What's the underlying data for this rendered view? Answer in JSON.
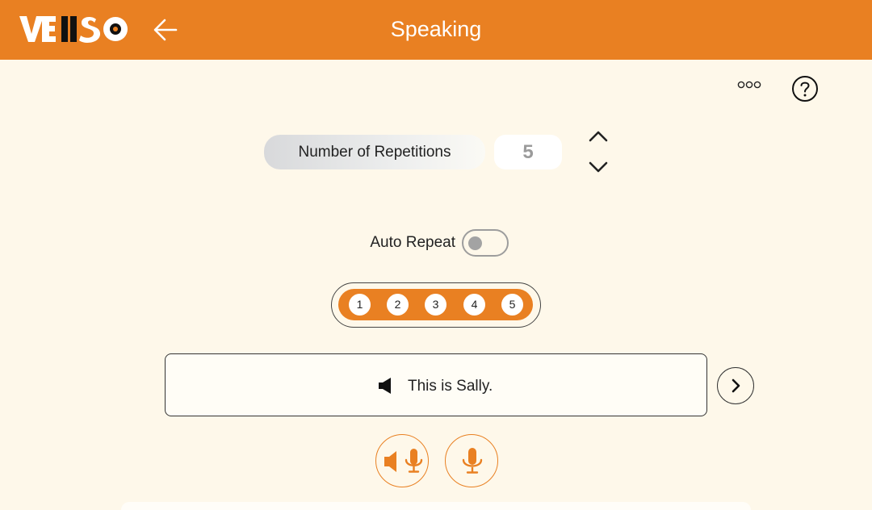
{
  "header": {
    "logo_text": "VEIISO",
    "title": "Speaking",
    "back_icon": "arrow-left-icon",
    "background_color": "#e98022"
  },
  "toolbar": {
    "more_icon": "more-dots-icon",
    "help_icon": "question-circle-icon"
  },
  "repetitions": {
    "label": "Number of Repetitions",
    "value": "5"
  },
  "auto_repeat": {
    "label": "Auto Repeat",
    "enabled": false
  },
  "steps": [
    "1",
    "2",
    "3",
    "4",
    "5"
  ],
  "sentence": {
    "text": "This is Sally."
  },
  "actions": {
    "listen_speak_icon": "speaker-mic-icon",
    "record_icon": "mic-icon",
    "accent_color": "#e98022"
  }
}
